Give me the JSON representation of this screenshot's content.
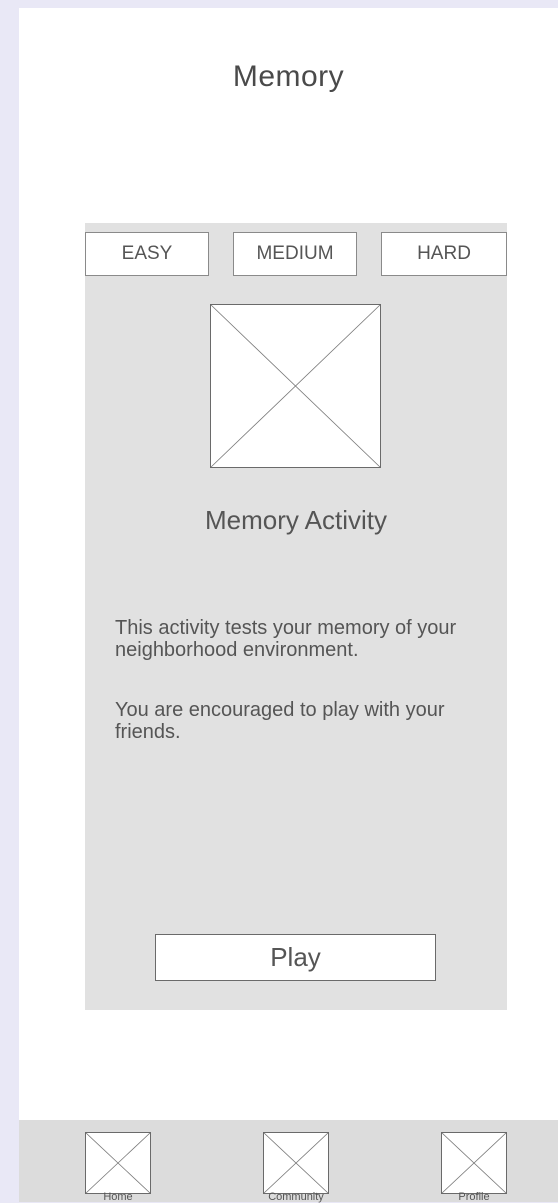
{
  "header": {
    "title": "Memory"
  },
  "difficulty": {
    "easy": "EASY",
    "medium": "MEDIUM",
    "hard": "HARD"
  },
  "activity": {
    "title": "Memory Activity",
    "description_1": "This activity tests your memory of your neighborhood environment.",
    "description_2": "You are encouraged to play with your friends.",
    "play_label": "Play"
  },
  "tabbar": {
    "items": [
      {
        "label": "Home",
        "icon": "image-placeholder-icon"
      },
      {
        "label": "Community",
        "icon": "image-placeholder-icon"
      },
      {
        "label": "Profile",
        "icon": "image-placeholder-icon"
      }
    ]
  },
  "colors": {
    "page_background": "#e9e8f6",
    "card_background": "#e1e1e1",
    "tabbar_background": "#dcdcdc"
  }
}
